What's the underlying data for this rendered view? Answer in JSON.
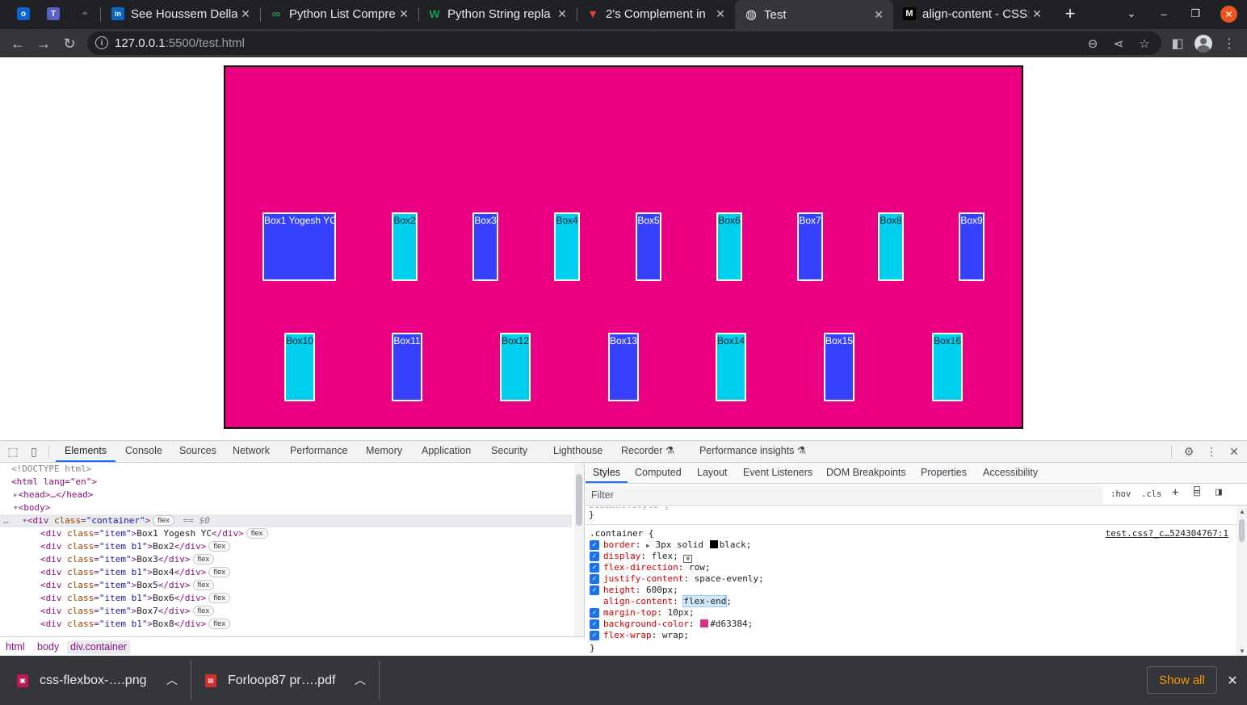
{
  "browser": {
    "pinned_tabs": [
      {
        "icon": "outlook-icon",
        "glyph": "o",
        "color": "#0a64d6"
      },
      {
        "icon": "teams-icon",
        "glyph": "T",
        "color": "#5b5fc7"
      },
      {
        "icon": "github-icon",
        "glyph": "◓",
        "color": "#202124"
      }
    ],
    "tabs": [
      {
        "title": "See Houssem Della",
        "icon": "linkedin-icon",
        "glyph": "in",
        "icon_color": "#0a66c2",
        "active": false
      },
      {
        "title": "Python List Compre",
        "icon": "geeksforgeeks-icon",
        "glyph": "∞",
        "icon_color": "#2f8d46",
        "active": false
      },
      {
        "title": "Python String repla",
        "icon": "w3resource-icon",
        "glyph": "W",
        "icon_color": "#0f9d58",
        "active": false
      },
      {
        "title": "2's Complement in",
        "icon": "vivaldi-icon",
        "glyph": "▼",
        "icon_color": "#ef3939",
        "active": false
      },
      {
        "title": "Test",
        "icon": "globe-icon",
        "glyph": "◍",
        "icon_color": "#e8eaed",
        "active": true
      },
      {
        "title": "align-content - CSS:",
        "icon": "mdn-icon",
        "glyph": "M",
        "icon_color": "#ffffff",
        "active": false
      }
    ],
    "url_host": "127.0.0.1",
    "url_rest": ":5500/test.html"
  },
  "page": {
    "row1": [
      "Box1 Yogesh YC",
      "Box2",
      "Box3",
      "Box4",
      "Box5",
      "Box6",
      "Box7",
      "Box8",
      "Box9"
    ],
    "row2": [
      "Box10",
      "Box11",
      "Box12",
      "Box13",
      "Box14",
      "Box15",
      "Box16"
    ],
    "colors": {
      "container": "#eb0083",
      "dark_box": "#3541ff",
      "light_box": "#00d0f0"
    }
  },
  "devtools": {
    "tabs": [
      "Elements",
      "Console",
      "Sources",
      "Network",
      "Performance",
      "Memory",
      "Application",
      "Security",
      "Lighthouse",
      "Recorder ⚗",
      "Performance insights ⚗"
    ],
    "dom": {
      "doctype": "<!DOCTYPE html>",
      "html_open": "<html lang=\"en\">",
      "head": "<head>…</head>",
      "body_open": "<body>",
      "container_tag": "div",
      "container_attr": "class",
      "container_val": "\"container\"",
      "container_badge": "flex",
      "container_eq": "== $0",
      "items": [
        {
          "cls": "\"item\"",
          "text": "Box1 Yogesh YC"
        },
        {
          "cls": "\"item b1\"",
          "text": "Box2"
        },
        {
          "cls": "\"item\"",
          "text": "Box3"
        },
        {
          "cls": "\"item b1\"",
          "text": "Box4"
        },
        {
          "cls": "\"item\"",
          "text": "Box5"
        },
        {
          "cls": "\"item b1\"",
          "text": "Box6"
        },
        {
          "cls": "\"item\"",
          "text": "Box7"
        },
        {
          "cls": "\"item b1\"",
          "text": "Box8"
        }
      ],
      "item_badge": "flex"
    },
    "breadcrumbs": [
      "html",
      "body",
      "div.container"
    ],
    "styles_tabs": [
      "Styles",
      "Computed",
      "Layout",
      "Event Listeners",
      "DOM Breakpoints",
      "Properties",
      "Accessibility"
    ],
    "filter_placeholder": "Filter",
    "hov": ":hov",
    "cls": ".cls",
    "prev_rule_close": "}",
    "rule": {
      "selector": ".container {",
      "source": "test.css?_c…524304767:1",
      "close": "}",
      "props": [
        {
          "name": "border",
          "value": "3px solid",
          "swatch": "#000000",
          "after": "black;",
          "arrow": true,
          "checked": true
        },
        {
          "name": "display",
          "value": "flex;",
          "grid_icon": true,
          "checked": true
        },
        {
          "name": "flex-direction",
          "value": "row;",
          "checked": true
        },
        {
          "name": "justify-content",
          "value": "space-evenly;",
          "checked": true
        },
        {
          "name": "height",
          "value": "600px;",
          "checked": true
        },
        {
          "name": "align-content",
          "value": "flex-end",
          "tail": ";",
          "highlight": true,
          "checked": false
        },
        {
          "name": "margin-top",
          "value": "10px;",
          "checked": true
        },
        {
          "name": "background-color",
          "value": "",
          "swatch": "#d63384",
          "after": "#d63384;",
          "checked": true
        },
        {
          "name": "flex-wrap",
          "value": "wrap;",
          "checked": true
        }
      ]
    }
  },
  "downloads": [
    {
      "name": "css-flexbox-….png",
      "icon": "image-file-icon",
      "color": "#c2185b"
    },
    {
      "name": "Forloop87 pr….pdf",
      "icon": "pdf-file-icon",
      "color": "#d32f2f"
    }
  ],
  "show_all": "Show all"
}
